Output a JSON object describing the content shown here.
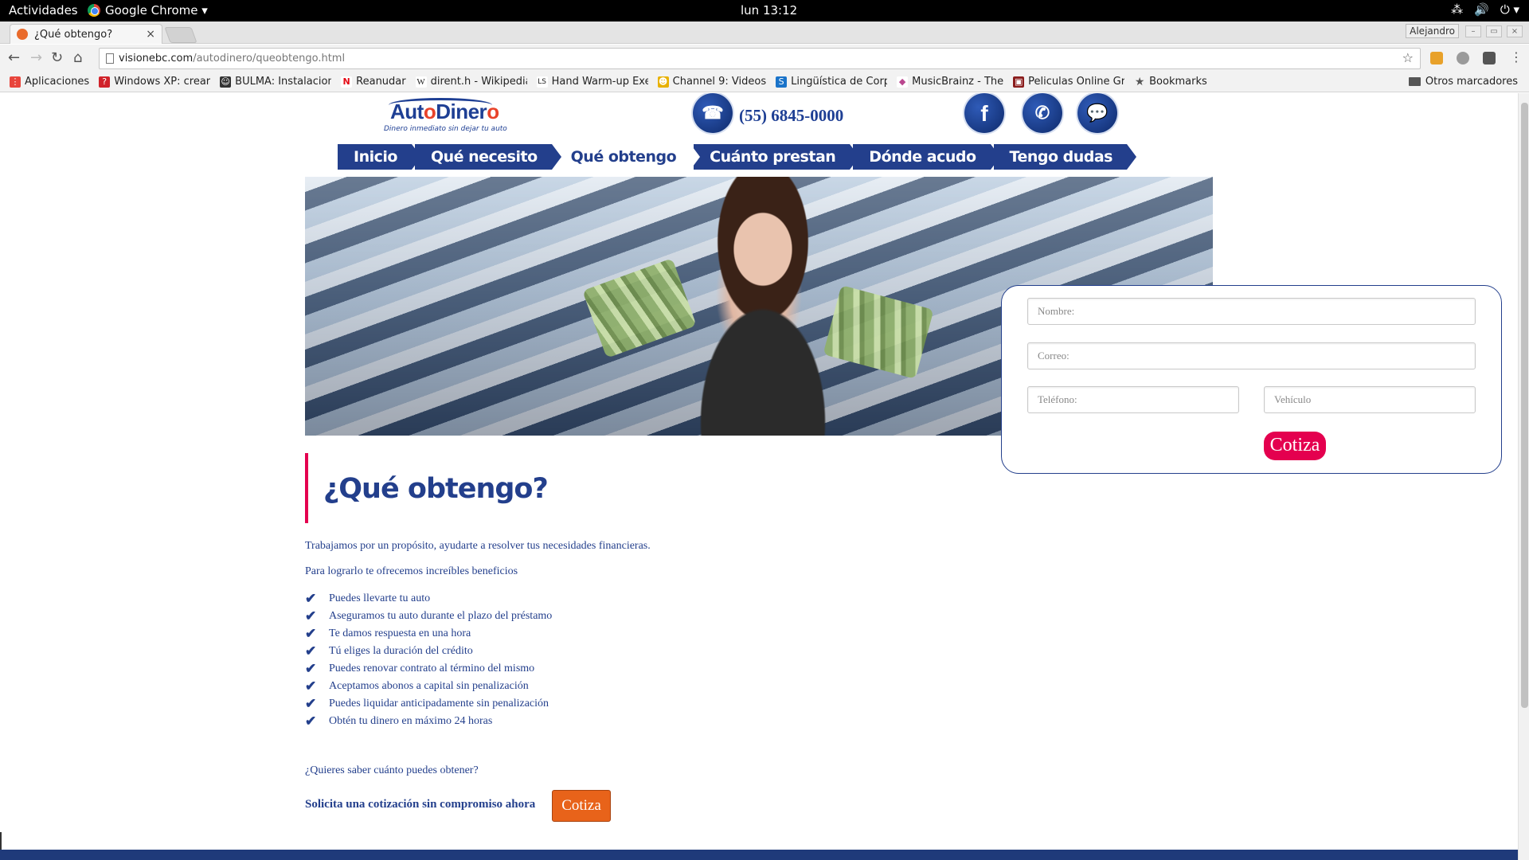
{
  "topbar": {
    "activities": "Actividades",
    "app_name": "Google Chrome ▾",
    "clock": "lun 13:12",
    "tray": [
      "⁂",
      "🔊",
      "⏻ ▾"
    ]
  },
  "browser": {
    "tab_title": "¿Qué obtengo?",
    "tab_close": "×",
    "profile": "Alejandro",
    "url_domain": "visionebc.com",
    "url_path": "/autodinero/queobtengo.html",
    "bookmarks": [
      {
        "label": "Aplicaciones",
        "color": "#e8453c",
        "glyph": "⋮"
      },
      {
        "label": "Windows XP: crear",
        "color": "#d0222a",
        "glyph": "?"
      },
      {
        "label": "BULMA: Instalacion",
        "color": "#333333",
        "glyph": "☺"
      },
      {
        "label": "Reanudar",
        "color": "#e50914",
        "glyph": "N"
      },
      {
        "label": "dirent.h - Wikipedia",
        "color": "#ffffff",
        "glyph": "W"
      },
      {
        "label": "Hand Warm-up Exe",
        "color": "#ffffff",
        "glyph": "LS"
      },
      {
        "label": "Channel 9: Videos",
        "color": "#e8b100",
        "glyph": "☻"
      },
      {
        "label": "Lingüística de Corp",
        "color": "#1a73c9",
        "glyph": "S"
      },
      {
        "label": "MusicBrainz - The",
        "color": "#ba478f",
        "glyph": "◆"
      },
      {
        "label": "Peliculas Online Gra",
        "color": "#8a1c1c",
        "glyph": "▣"
      },
      {
        "label": "Bookmarks",
        "color": "#555555",
        "glyph": "★"
      }
    ],
    "other_bookmarks": "Otros marcadores"
  },
  "site": {
    "logo_prefix": "Aut",
    "logo_o": "o",
    "logo_suffix": "Diner",
    "logo_end": "o",
    "logo_tagline": "Dinero inmediato sin dejar tu auto",
    "phone": "(55) 6845-0000",
    "nav": [
      "Inicio",
      "Qué necesito",
      "Qué obtengo",
      "Cuánto prestan",
      "Dónde acudo",
      "Tengo dudas"
    ],
    "nav_active": "Qué obtengo",
    "form": {
      "name_placeholder": "Nombre:",
      "email_placeholder": "Correo:",
      "phone_placeholder": "Teléfono:",
      "vehicle_placeholder": "Vehículo",
      "submit": "Cotiza"
    },
    "title": "¿Qué obtengo?",
    "intro": "Trabajamos por un propósito, ayudarte a resolver tus necesidades financieras.",
    "lead": "Para lograrlo te ofrecemos increíbles beneficios",
    "benefits": [
      "Puedes llevarte tu auto",
      "Aseguramos tu auto durante el plazo del préstamo",
      "Te damos respuesta en una hora",
      "Tú eliges la duración del crédito",
      "Puedes renovar contrato al término del mismo",
      "Aceptamos abonos a capital sin penalización",
      "Puedes liquidar anticipadamente sin penalización",
      "Obtén tu dinero en máximo 24 horas"
    ],
    "question": "¿Quieres saber cuánto puedes obtener?",
    "cta_text": "Solicita una cotización sin compromiso ahora",
    "cta_button": "Cotiza"
  },
  "colors": {
    "brand_blue": "#233f8c",
    "accent_red": "#e4004f",
    "accent_orange": "#e8631a"
  }
}
